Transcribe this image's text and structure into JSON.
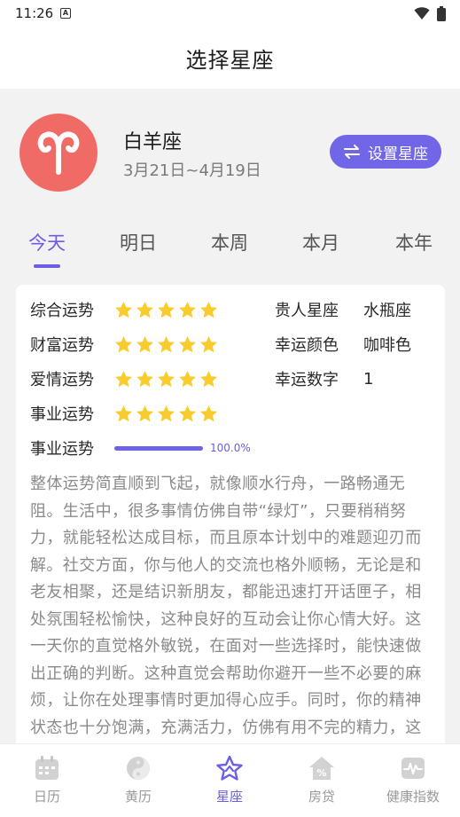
{
  "status": {
    "time": "11:26",
    "a_badge": "A"
  },
  "header": {
    "title": "选择星座"
  },
  "sign": {
    "name": "白羊座",
    "date_range": "3月21日~4月19日",
    "set_button": "设置星座"
  },
  "tabs": [
    {
      "label": "今天",
      "active": true
    },
    {
      "label": "明日",
      "active": false
    },
    {
      "label": "本周",
      "active": false
    },
    {
      "label": "本月",
      "active": false
    },
    {
      "label": "本年",
      "active": false
    }
  ],
  "fortune": {
    "rows": [
      {
        "label": "综合运势",
        "stars": 5
      },
      {
        "label": "财富运势",
        "stars": 5
      },
      {
        "label": "爱情运势",
        "stars": 5
      },
      {
        "label": "事业运势",
        "stars": 5
      }
    ],
    "progress": {
      "label": "事业运势",
      "value": 1.0,
      "text": "100.0%"
    },
    "info": [
      {
        "key": "贵人星座",
        "value": "水瓶座"
      },
      {
        "key": "幸运颜色",
        "value": "咖啡色"
      },
      {
        "key": "幸运数字",
        "value": "1"
      }
    ],
    "description": "整体运势简直顺到飞起，就像顺水行舟，一路畅通无阻。生活中，很多事情仿佛自带“绿灯”，只要稍稍努力，就能轻松达成目标，而且原本计划中的难题迎刃而解。社交方面，你与他人的交流也格外顺畅，无论是和老友相聚，还是结识新朋友，都能迅速打开话匣子，相处氛围轻松愉快，这种良好的互动会让你心情大好。这一天你的直觉格外敏锐，在面对一些选择时，能快速做出正确的判断。这种直觉会帮助你避开一些不必要的麻烦，让你在处理事情时更加得心应手。同时，你的精神状态也十分饱满，充满活力，仿佛有用不完的精力，这种积极的"
  },
  "nav": [
    {
      "label": "日历",
      "icon": "calendar-icon",
      "active": false
    },
    {
      "label": "黄历",
      "icon": "yin-yang-icon",
      "active": false
    },
    {
      "label": "星座",
      "icon": "star-icon",
      "active": true
    },
    {
      "label": "房贷",
      "icon": "house-percent-icon",
      "active": false
    },
    {
      "label": "健康指数",
      "icon": "heart-rate-icon",
      "active": false
    }
  ],
  "colors": {
    "accent": "#6a5ee6",
    "sign_bg": "#f06a66",
    "star": "#f8cc2c"
  }
}
